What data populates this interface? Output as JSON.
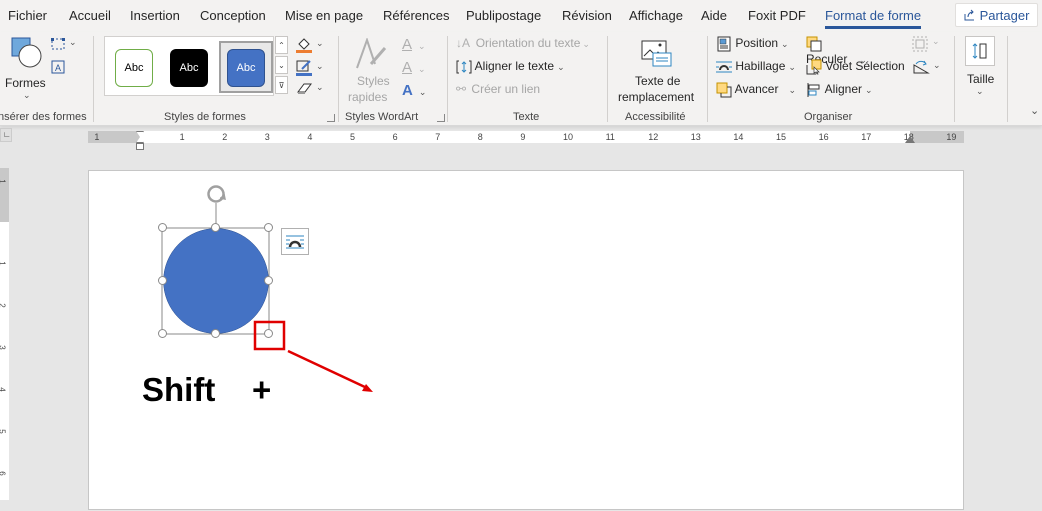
{
  "tabs": [
    {
      "label": "Fichier",
      "active": false
    },
    {
      "label": "Accueil",
      "active": false
    },
    {
      "label": "Insertion",
      "active": false
    },
    {
      "label": "Conception",
      "active": false
    },
    {
      "label": "Mise en page",
      "active": false
    },
    {
      "label": "Références",
      "active": false
    },
    {
      "label": "Publipostage",
      "active": false
    },
    {
      "label": "Révision",
      "active": false
    },
    {
      "label": "Affichage",
      "active": false
    },
    {
      "label": "Aide",
      "active": false
    },
    {
      "label": "Foxit PDF",
      "active": false
    },
    {
      "label": "Format de forme",
      "active": true
    }
  ],
  "share_label": "Partager",
  "ribbon": {
    "insert_shapes": {
      "formes_label": "Formes",
      "group_label": "nsérer des formes"
    },
    "shape_styles": {
      "samples": [
        {
          "label": "Abc",
          "style": "outline-green"
        },
        {
          "label": "Abc",
          "style": "black-fill"
        },
        {
          "label": "Abc",
          "style": "blue-fill",
          "selected": true
        }
      ],
      "group_label": "Styles de formes",
      "fill_color": "#ed7d31",
      "outline_color": "#4472c4"
    },
    "wordart": {
      "quick_styles_line1": "Styles",
      "quick_styles_line2": "rapides",
      "group_label": "Styles WordArt"
    },
    "text": {
      "orientation": "Orientation du texte",
      "align": "Aligner le texte",
      "link": "Créer un lien",
      "group_label": "Texte"
    },
    "accessibility": {
      "alt_line1": "Texte de",
      "alt_line2": "remplacement",
      "group_label": "Accessibilité"
    },
    "arrange": {
      "position": "Position",
      "wrap": "Habillage",
      "forward": "Avancer",
      "backward": "Reculer",
      "selection_pane": "Volet Sélection",
      "align": "Aligner",
      "group_label": "Organiser"
    },
    "size": {
      "label": "Taille"
    }
  },
  "ruler": {
    "h_labels": [
      "1",
      "1",
      "2",
      "3",
      "4",
      "5",
      "6",
      "7",
      "8",
      "9",
      "10",
      "11",
      "12",
      "13",
      "14",
      "15",
      "16",
      "17",
      "18",
      "19"
    ],
    "v_labels": [
      "1",
      "1",
      "2",
      "3",
      "4",
      "5",
      "6"
    ]
  },
  "document": {
    "shape": {
      "type": "circle",
      "fill": "#4472c4"
    },
    "annotation_text": "Shift    +",
    "highlight_color": "#e00000"
  }
}
